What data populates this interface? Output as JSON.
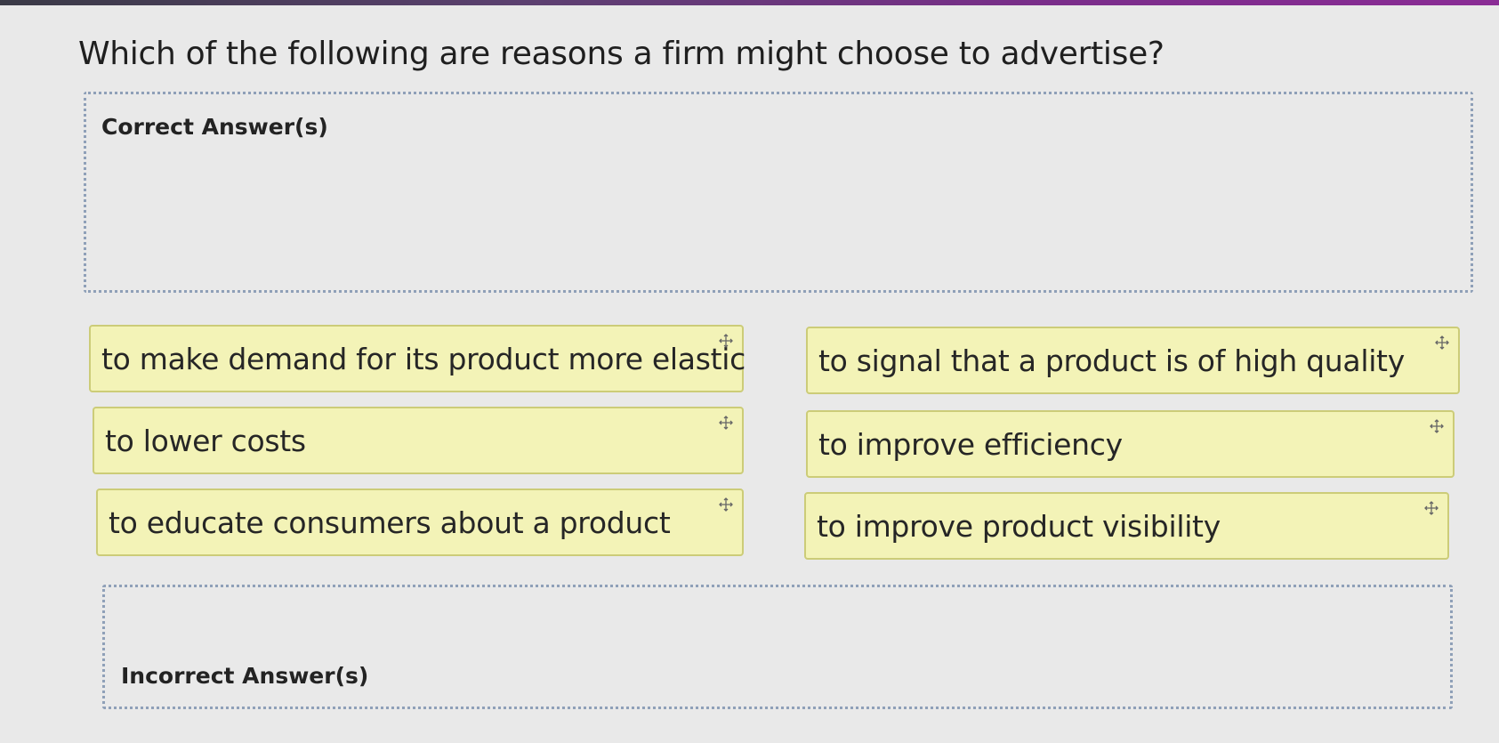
{
  "question": {
    "text": "Which of the following are reasons a firm might choose to advertise?"
  },
  "correct_zone": {
    "title": "Correct Answer(s)"
  },
  "incorrect_zone": {
    "title": "Incorrect Answer(s)"
  },
  "cards": [
    {
      "label": "to make demand for its product more elastic",
      "icon": "move-icon"
    },
    {
      "label": "to signal that a product is of high quality",
      "icon": "move-icon"
    },
    {
      "label": "to lower costs",
      "icon": "move-icon"
    },
    {
      "label": "to improve efficiency",
      "icon": "move-icon"
    },
    {
      "label": "to educate consumers about a product",
      "icon": "move-icon"
    },
    {
      "label": "to improve product visibility",
      "icon": "move-icon"
    }
  ],
  "colors": {
    "card_background": "#f3f3b7",
    "card_border": "#cccc78",
    "zone_border": "#8fa0b8",
    "page_background": "#e9e9e9",
    "accent_bar": "#7a2d8a"
  }
}
